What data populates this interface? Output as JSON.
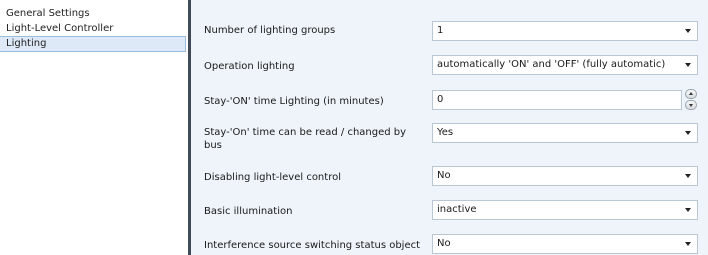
{
  "sidebar": {
    "items": [
      {
        "label": "General Settings"
      },
      {
        "label": "Light-Level Controller"
      },
      {
        "label": "Lighting"
      }
    ]
  },
  "parameters": {
    "number_of_lighting_groups": {
      "label": "Number of lighting groups",
      "value": "1"
    },
    "operation_lighting": {
      "label": "Operation lighting",
      "value": "automatically 'ON' and 'OFF' (fully automatic)"
    },
    "stay_on_time": {
      "label": "Stay-'ON' time Lighting (in minutes)",
      "value": "0"
    },
    "stay_on_time_bus": {
      "label": "Stay-'On' time can be read / changed by bus",
      "value": "Yes"
    },
    "disabling_light_level_control": {
      "label": "Disabling light-level control",
      "value": "No"
    },
    "basic_illumination": {
      "label": "Basic illumination",
      "value": "inactive"
    },
    "interference_source": {
      "label": "Interference source switching status object",
      "value": "No"
    }
  }
}
